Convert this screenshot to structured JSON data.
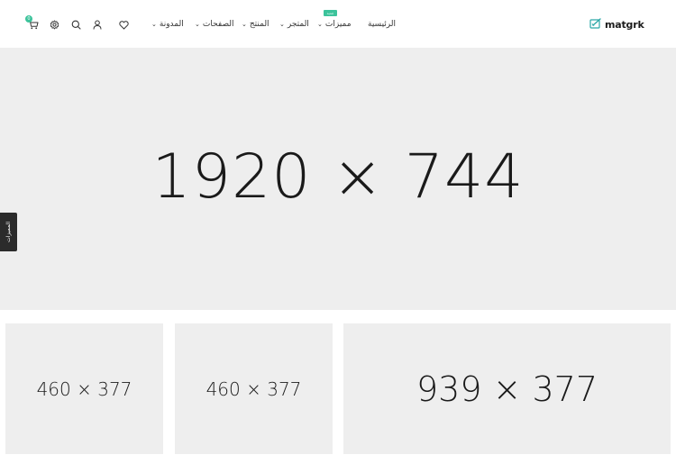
{
  "brand": {
    "logo_text": "matgrk",
    "accent": "#3cc39b"
  },
  "nav": {
    "home": "الرئيسية",
    "features": "مميزات",
    "features_badge": "جديد",
    "shop": "المتجر",
    "product": "المنتج",
    "pages": "الصفحات",
    "blog": "المدونة"
  },
  "header_icons": [
    "heart-icon",
    "user-icon",
    "search-icon",
    "gear-icon",
    "cart-icon"
  ],
  "cart": {
    "count": "0"
  },
  "side_tab": {
    "label": "المميزات"
  },
  "hero": {
    "text": "1920 × 744",
    "background": "#eeeeee"
  },
  "banners": [
    {
      "text": "460 × 377"
    },
    {
      "text": "460 × 377"
    },
    {
      "text": "939 × 377"
    }
  ]
}
